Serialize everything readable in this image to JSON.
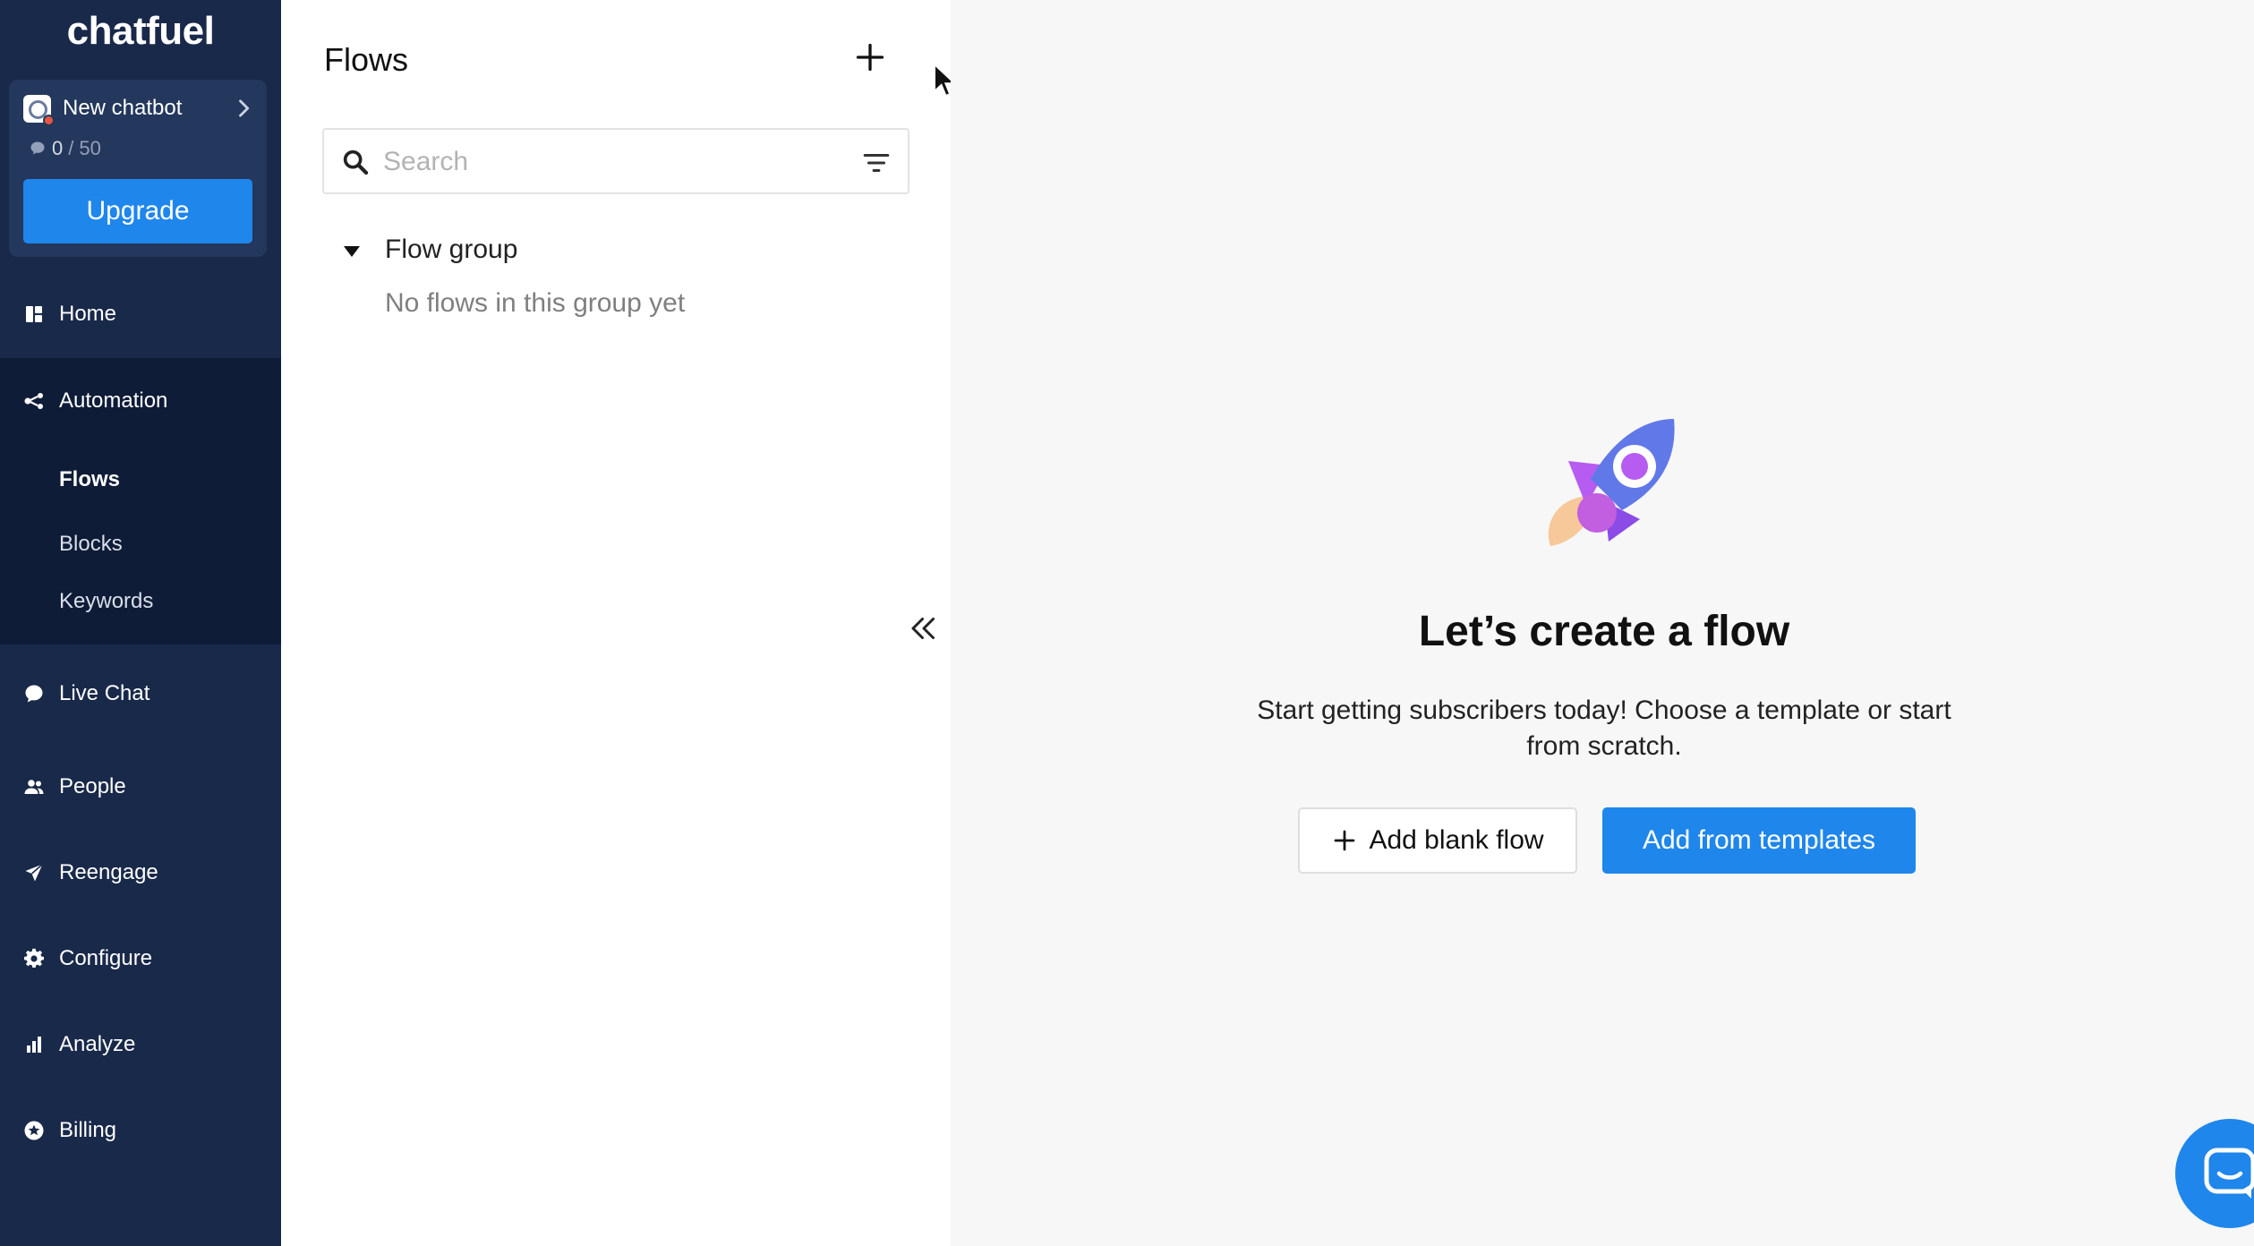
{
  "app": {
    "logo": "chatfuel"
  },
  "bot": {
    "name": "New chatbot",
    "usage_current": "0",
    "usage_separator": "/",
    "usage_limit": "50",
    "upgrade_label": "Upgrade"
  },
  "nav": {
    "home": "Home",
    "automation": "Automation",
    "automation_sub": {
      "flows": "Flows",
      "blocks": "Blocks",
      "keywords": "Keywords"
    },
    "live_chat": "Live Chat",
    "people": "People",
    "reengage": "Reengage",
    "configure": "Configure",
    "analyze": "Analyze",
    "billing": "Billing"
  },
  "flows_panel": {
    "title": "Flows",
    "search_placeholder": "Search",
    "group_name": "Flow group",
    "group_empty": "No flows in this group yet"
  },
  "main": {
    "title": "Let’s create a flow",
    "description": "Start getting subscribers today! Choose a template or start from scratch.",
    "add_blank_label": "Add blank flow",
    "add_templates_label": "Add from templates"
  },
  "colors": {
    "sidebar_bg": "#19294a",
    "sidebar_active_bg": "#0f1c38",
    "accent": "#1f86eb"
  }
}
